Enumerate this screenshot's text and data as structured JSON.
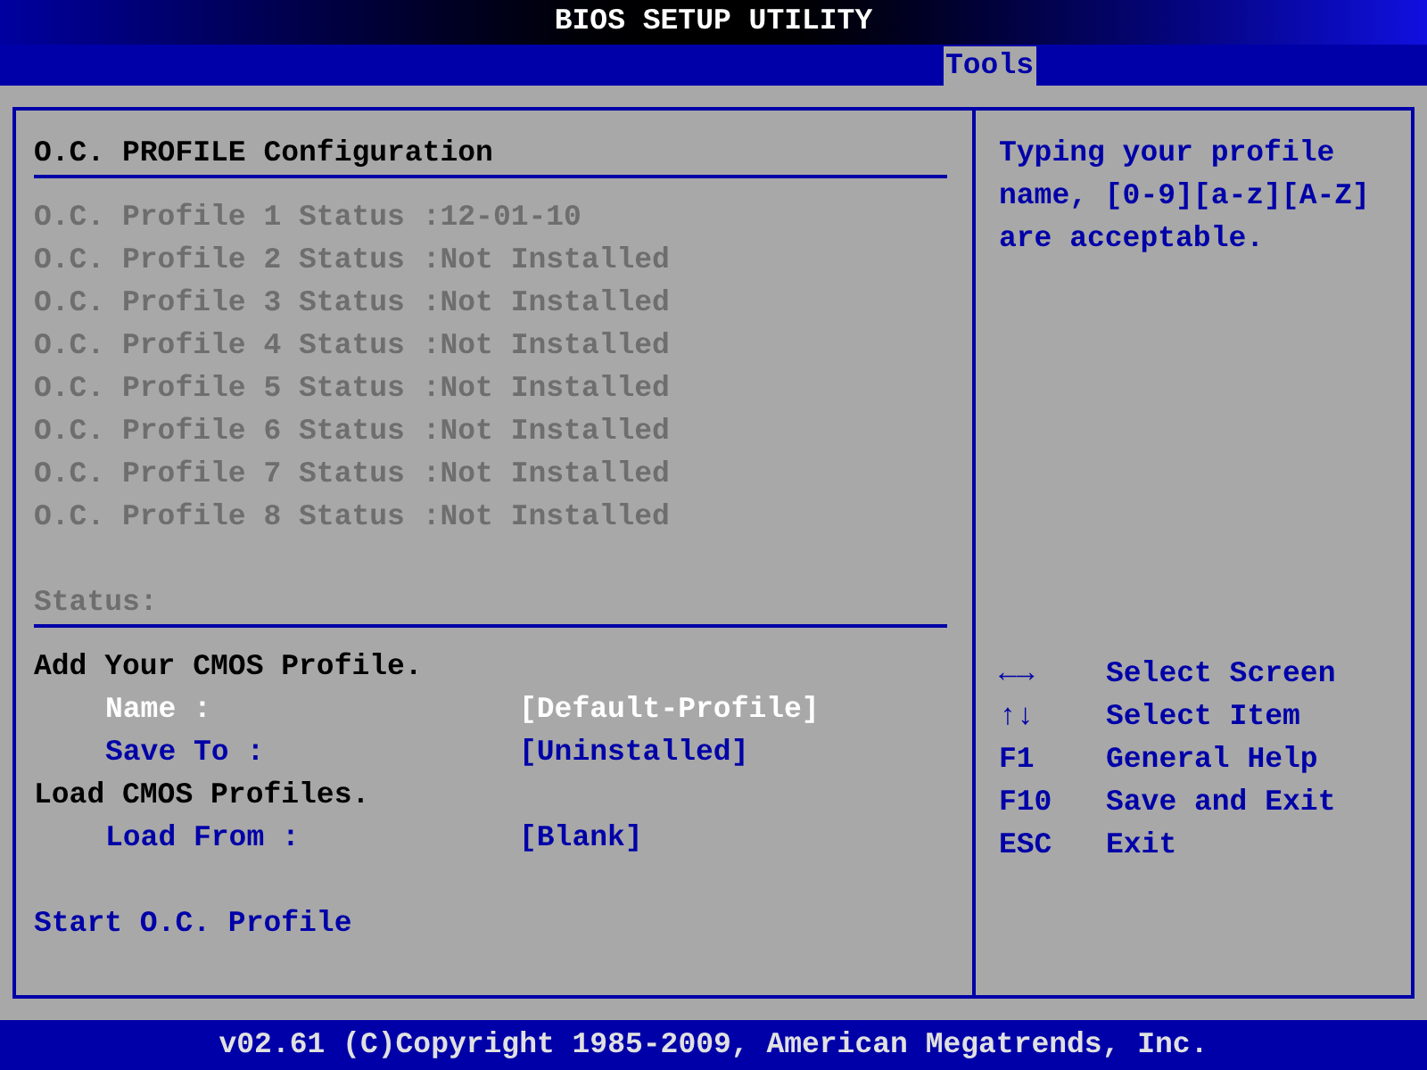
{
  "title": "BIOS SETUP UTILITY",
  "tabs": [
    {
      "label": "Tools",
      "selected": true
    }
  ],
  "section_title": "O.C. PROFILE Configuration",
  "profiles": [
    {
      "label": "O.C. Profile 1 Status :12-01-10",
      "disabled": true
    },
    {
      "label": "O.C. Profile 2 Status :Not Installed",
      "disabled": true
    },
    {
      "label": "O.C. Profile 3 Status :Not Installed",
      "disabled": true
    },
    {
      "label": "O.C. Profile 4 Status :Not Installed",
      "disabled": true
    },
    {
      "label": "O.C. Profile 5 Status :Not Installed",
      "disabled": true
    },
    {
      "label": "O.C. Profile 6 Status :Not Installed",
      "disabled": true
    },
    {
      "label": "O.C. Profile 7 Status :Not Installed",
      "disabled": true
    },
    {
      "label": "O.C. Profile 8 Status :Not Installed",
      "disabled": true
    }
  ],
  "status_label": "Status:",
  "items": [
    {
      "kind": "heading",
      "label": "Add Your CMOS Profile."
    },
    {
      "kind": "option",
      "label": "Name :",
      "value": "[Default-Profile]",
      "selected": true
    },
    {
      "kind": "option",
      "label": "Save To :",
      "value": "[Uninstalled]",
      "selected": false
    },
    {
      "kind": "heading",
      "label": "Load CMOS Profiles."
    },
    {
      "kind": "option",
      "label": "Load From :",
      "value": "[Blank]",
      "selected": false
    },
    {
      "kind": "action",
      "label": "Start O.C. Profile",
      "selected": false
    }
  ],
  "help": "Typing your profile name, [0-9][a-z][A-Z] are acceptable.",
  "keys": [
    {
      "key": "←→",
      "action": "Select Screen"
    },
    {
      "key": "↑↓",
      "action": "Select Item"
    },
    {
      "key": "F1",
      "action": "General Help"
    },
    {
      "key": "F10",
      "action": "Save and Exit"
    },
    {
      "key": "ESC",
      "action": "Exit"
    }
  ],
  "footer": "v02.61 (C)Copyright 1985-2009, American Megatrends, Inc."
}
